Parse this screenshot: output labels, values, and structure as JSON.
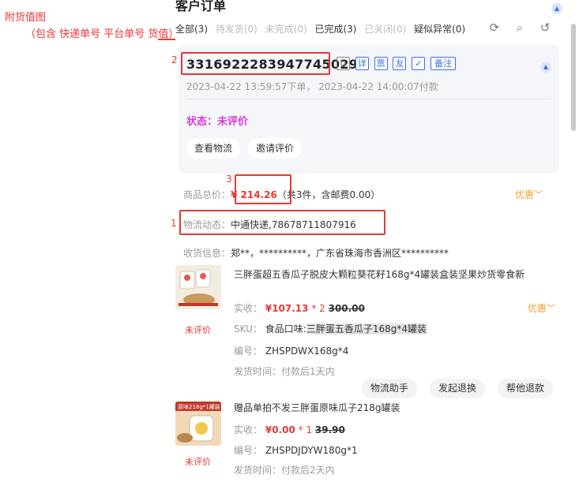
{
  "annotation": {
    "title": "附货值图",
    "subtitle": "（包含 快递单号 平台单号 货值）",
    "markers": [
      "1",
      "2",
      "3"
    ]
  },
  "panel": {
    "title": "客户订单",
    "tabs": [
      {
        "label": "全部(3)"
      },
      {
        "label": "待发货(0)"
      },
      {
        "label": "未完成(0)"
      },
      {
        "label": "已完成(3)"
      },
      {
        "label": "已关闭(0)"
      },
      {
        "label": "疑似异常(0)"
      }
    ],
    "icons": [
      "refresh-icon",
      "search-icon",
      "history-icon"
    ]
  },
  "order": {
    "order_no": "3316922283947745029",
    "badges": {
      "copy": "⧉",
      "detail": "详",
      "invoice": "票",
      "friend": "友",
      "check": "✓",
      "note": "备注"
    },
    "time": "2023-04-22 13:59:57下单， 2023-04-22 14:00:07付款",
    "status": "状态：未评价",
    "btn_logistics": "查看物流",
    "btn_invite": "邀请评价"
  },
  "summary": {
    "total_label": "商品总价：",
    "total_value": "¥ 214.26",
    "total_note": "（共3件，含邮费0.00）",
    "promo": "优惠",
    "logistics_label": "物流动态：",
    "logistics_value": "中通快递,78678711807916",
    "address_label": "收货信息：",
    "address_value": "郑**，**********，广东省珠海市香洲区**********"
  },
  "products": [
    {
      "title": "三胖蛋超五香瓜子脱皮大颗粒葵花籽168g*4罐装盒装坚果炒货零食新",
      "status": "未评价",
      "paid_label": "实收：",
      "paid": "¥107.13",
      "qty": "* 2",
      "orig": "300.00",
      "promo": "优惠",
      "sku_label": "SKU：",
      "sku_prefix": "食品口味:",
      "sku_value": "三胖蛋五香瓜子168g*4罐装",
      "code_label": "编号：",
      "code": "ZHSPDWX168g*4",
      "ship": "发货时间：付款后1天内"
    },
    {
      "title": "赠品单拍不发三胖蛋原味瓜子218g罐装",
      "status": "未评价",
      "paid_label": "实收：",
      "paid": "¥0.00",
      "qty": "* 1",
      "orig": "39.90",
      "code_label": "编号：",
      "code": "ZHSPDJDYW180g*1",
      "ship": "发货时间：付款后2天内",
      "thumb_label": "原味218g*1罐装"
    }
  ],
  "actions": {
    "logistics_helper": "物流助手",
    "exchange": "发起退换",
    "refund": "帮他退款"
  }
}
